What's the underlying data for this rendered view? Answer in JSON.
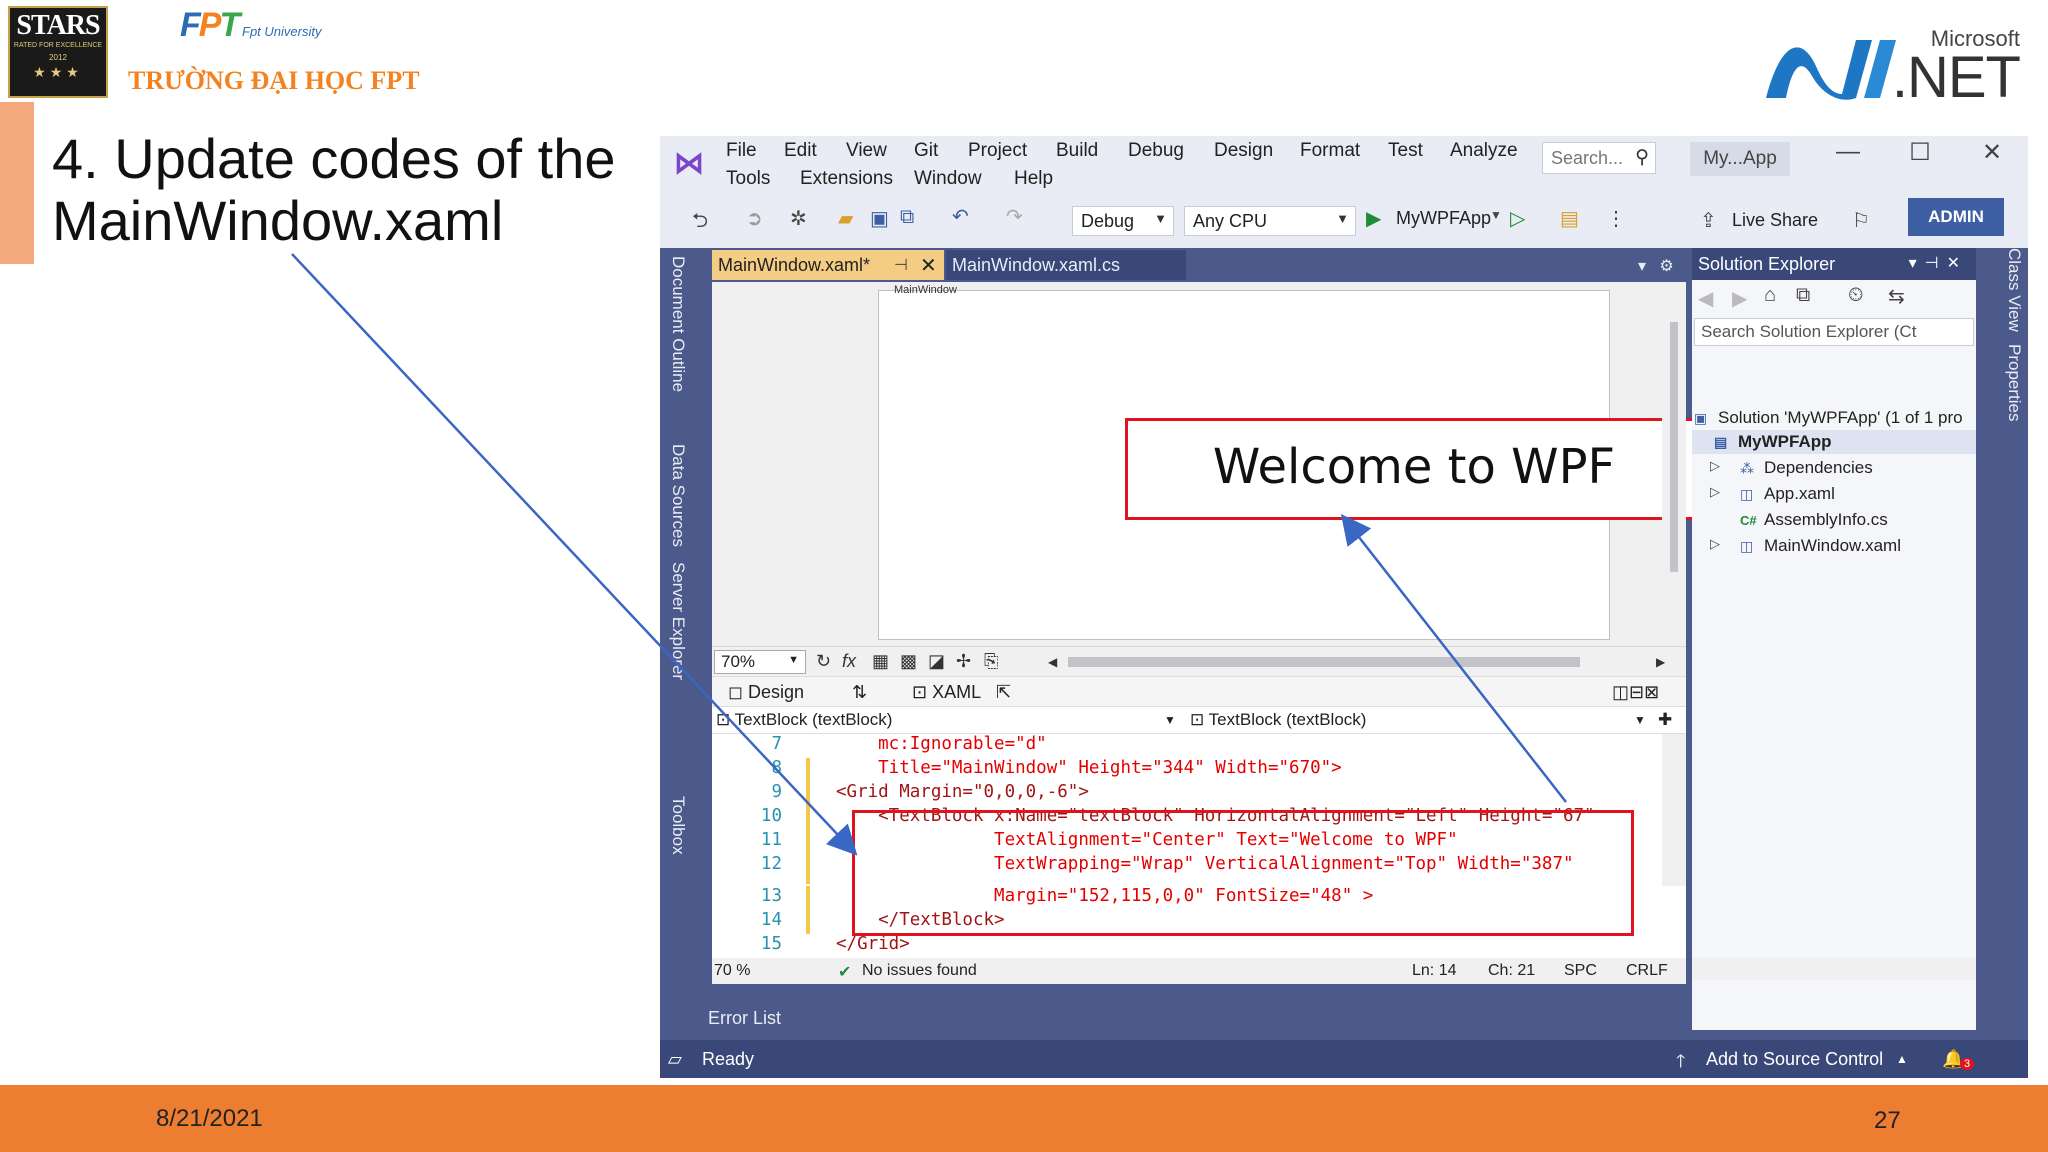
{
  "slide": {
    "title_line1": "4. Update codes of the",
    "title_line2": "MainWindow.xaml",
    "date": "8/21/2021",
    "page_number": "27",
    "logos": {
      "stars": "STARS",
      "stars_sub": "RATED FOR EXCELLENCE",
      "stars_year": "2012",
      "fpt_university": "Fpt University",
      "fpt_name": "TRƯỜNG ĐẠI HỌC FPT",
      "microsoft": "Microsoft",
      "net": ".NET"
    },
    "colors": {
      "footer": "#ed7d31",
      "accent": "#f4a97c",
      "annotation_red": "#e0141e",
      "arrow_blue": "#3a66c4"
    }
  },
  "vs": {
    "menu": [
      "File",
      "Edit",
      "View",
      "Git",
      "Project",
      "Build",
      "Debug",
      "Design",
      "Format",
      "Test",
      "Analyze",
      "Tools",
      "Extensions",
      "Window",
      "Help"
    ],
    "search_placeholder": "Search...",
    "app_name": "My...App",
    "toolbar": {
      "config": "Debug",
      "platform": "Any CPU",
      "run_target": "MyWPFApp",
      "live_share": "Live Share",
      "admin": "ADMIN"
    },
    "side_tabs": [
      "Document Outline",
      "Data Sources",
      "Server Explorer",
      "Toolbox"
    ],
    "right_tabs": [
      "Class View",
      "Properties"
    ],
    "doc_tabs": {
      "active": "MainWindow.xaml*",
      "other": "MainWindow.xaml.cs"
    },
    "designer": {
      "window_label": "MainWindow",
      "welcome_text": "Welcome to WPF",
      "zoom": "70%"
    },
    "view_tabs": {
      "design": "Design",
      "xaml": "XAML"
    },
    "nav": {
      "left": "TextBlock (textBlock)",
      "right": "TextBlock (textBlock)"
    },
    "code_lines": [
      {
        "n": "7",
        "text": "    mc:Ignorable=\"d\""
      },
      {
        "n": "8",
        "text": "    Title=\"MainWindow\" Height=\"344\" Width=\"670\">"
      },
      {
        "n": "9",
        "text": "<Grid Margin=\"0,0,0,-6\">"
      },
      {
        "n": "10",
        "text": "    <TextBlock x:Name=\"textBlock\" HorizontalAlignment=\"Left\" Height=\"67\""
      },
      {
        "n": "11",
        "text": "               TextAlignment=\"Center\" Text=\"Welcome to WPF\""
      },
      {
        "n": "12",
        "text": "               TextWrapping=\"Wrap\" VerticalAlignment=\"Top\" Width=\"387\""
      },
      {
        "n": "13",
        "text": "               Margin=\"152,115,0,0\" FontSize=\"48\" >"
      },
      {
        "n": "14",
        "text": "    </TextBlock>"
      },
      {
        "n": "15",
        "text": "</Grid>"
      }
    ],
    "editor_status": {
      "zoom": "70 %",
      "issues": "No issues found",
      "line": "Ln: 14",
      "col": "Ch: 21",
      "spc": "SPC",
      "eol": "CRLF"
    },
    "error_list": "Error List",
    "status": {
      "ready": "Ready",
      "source_control": "Add to Source Control",
      "notifications": "3"
    },
    "solution_explorer": {
      "title": "Solution Explorer",
      "search_placeholder": "Search Solution Explorer (Ct",
      "items": [
        {
          "label": "Solution 'MyWPFApp' (1 of 1 pro",
          "icon": "solution-icon"
        },
        {
          "label": "MyWPFApp",
          "icon": "csproj-icon"
        },
        {
          "label": "Dependencies",
          "icon": "dependencies-icon"
        },
        {
          "label": "App.xaml",
          "icon": "xaml-icon"
        },
        {
          "label": "AssemblyInfo.cs",
          "icon": "cs-file-icon"
        },
        {
          "label": "MainWindow.xaml",
          "icon": "xaml-icon"
        }
      ]
    }
  }
}
